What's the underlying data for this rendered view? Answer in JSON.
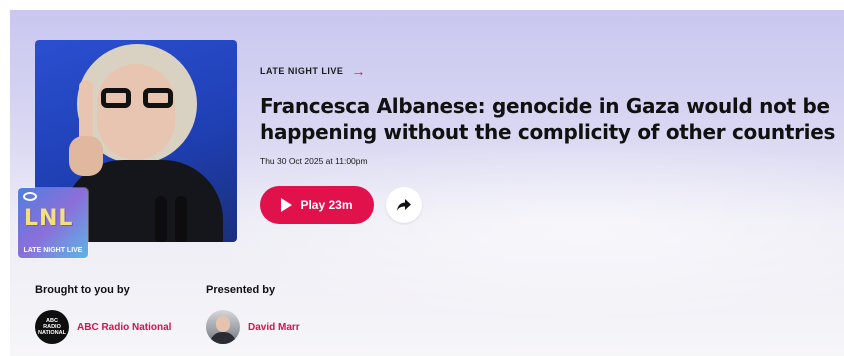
{
  "episode": {
    "program_label": "LATE NIGHT LIVE",
    "title": "Francesca Albanese: genocide in Gaza would not be happening without the complicity of other countries",
    "date": "Thu 30 Oct 2025 at 11:00pm",
    "play_label": "Play 23m"
  },
  "show_logo": {
    "letters": "LNL",
    "name": "LATE NIGHT LIVE"
  },
  "credits": {
    "brought_label": "Brought to you by",
    "network": "ABC Radio National",
    "network_logo_line1": "ABC",
    "network_logo_line2": "RADIO",
    "network_logo_line3": "NATIONAL",
    "presented_label": "Presented by",
    "presenter": "David Marr"
  },
  "colors": {
    "accent": "#e0114b",
    "link": "#d8124a",
    "background_top": "#c9c7ef"
  },
  "icons": {
    "program_arrow": "arrow-right-icon",
    "play": "play-icon",
    "share": "share-icon"
  }
}
